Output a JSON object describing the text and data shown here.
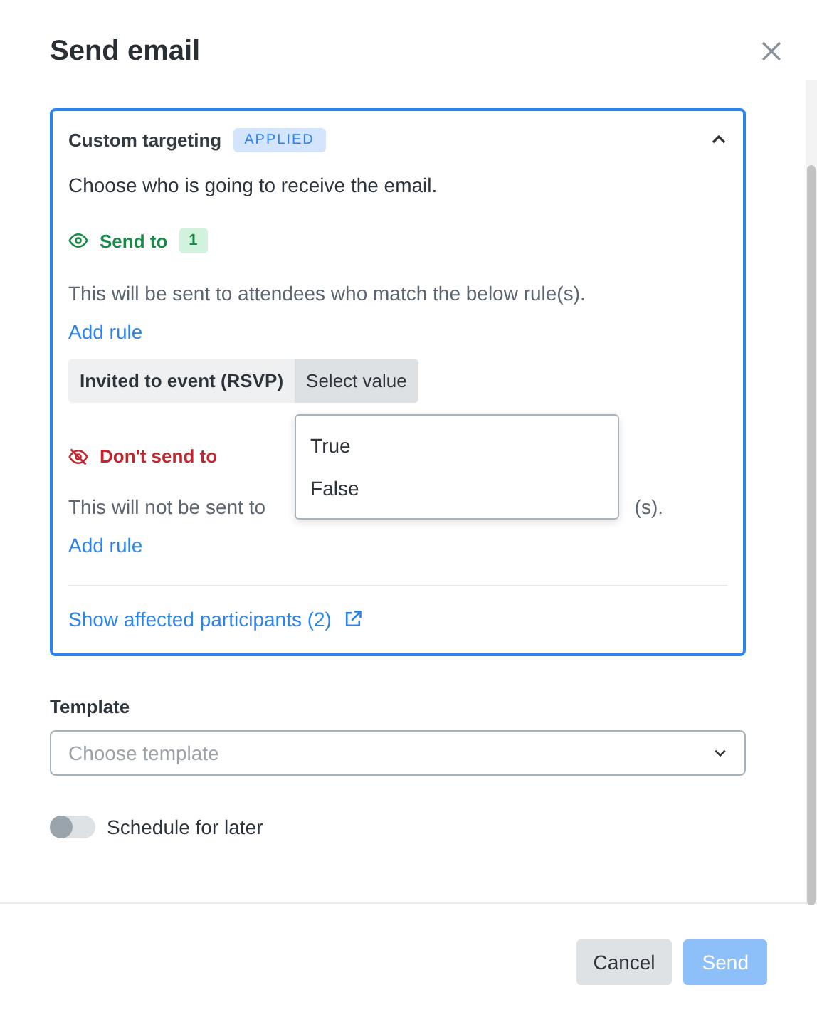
{
  "dialog": {
    "title": "Send email"
  },
  "targeting": {
    "title": "Custom targeting",
    "badge": "APPLIED",
    "expanded": true,
    "intro": "Choose who is going to receive the email.",
    "send_to": {
      "label": "Send to",
      "count": "1",
      "description": "This will be sent to attendees who match the below rule(s).",
      "add_rule": "Add rule",
      "rule": {
        "field": "Invited to event (RSVP)",
        "value": "Select value",
        "expanded": true,
        "options": [
          "True",
          "False"
        ]
      }
    },
    "dont_send_to": {
      "label": "Don't send to",
      "description_start": "This will not be sent to",
      "description_end": "(s).",
      "add_rule": "Add rule"
    },
    "affected_link": "Show affected participants (2)"
  },
  "template": {
    "label": "Template",
    "placeholder": "Choose template"
  },
  "schedule": {
    "label": "Schedule for later",
    "on": false
  },
  "buttons": [
    {
      "label": "Cancel",
      "kind": "secondary",
      "disabled": false
    },
    {
      "label": "Send",
      "kind": "primary",
      "disabled": true
    }
  ]
}
